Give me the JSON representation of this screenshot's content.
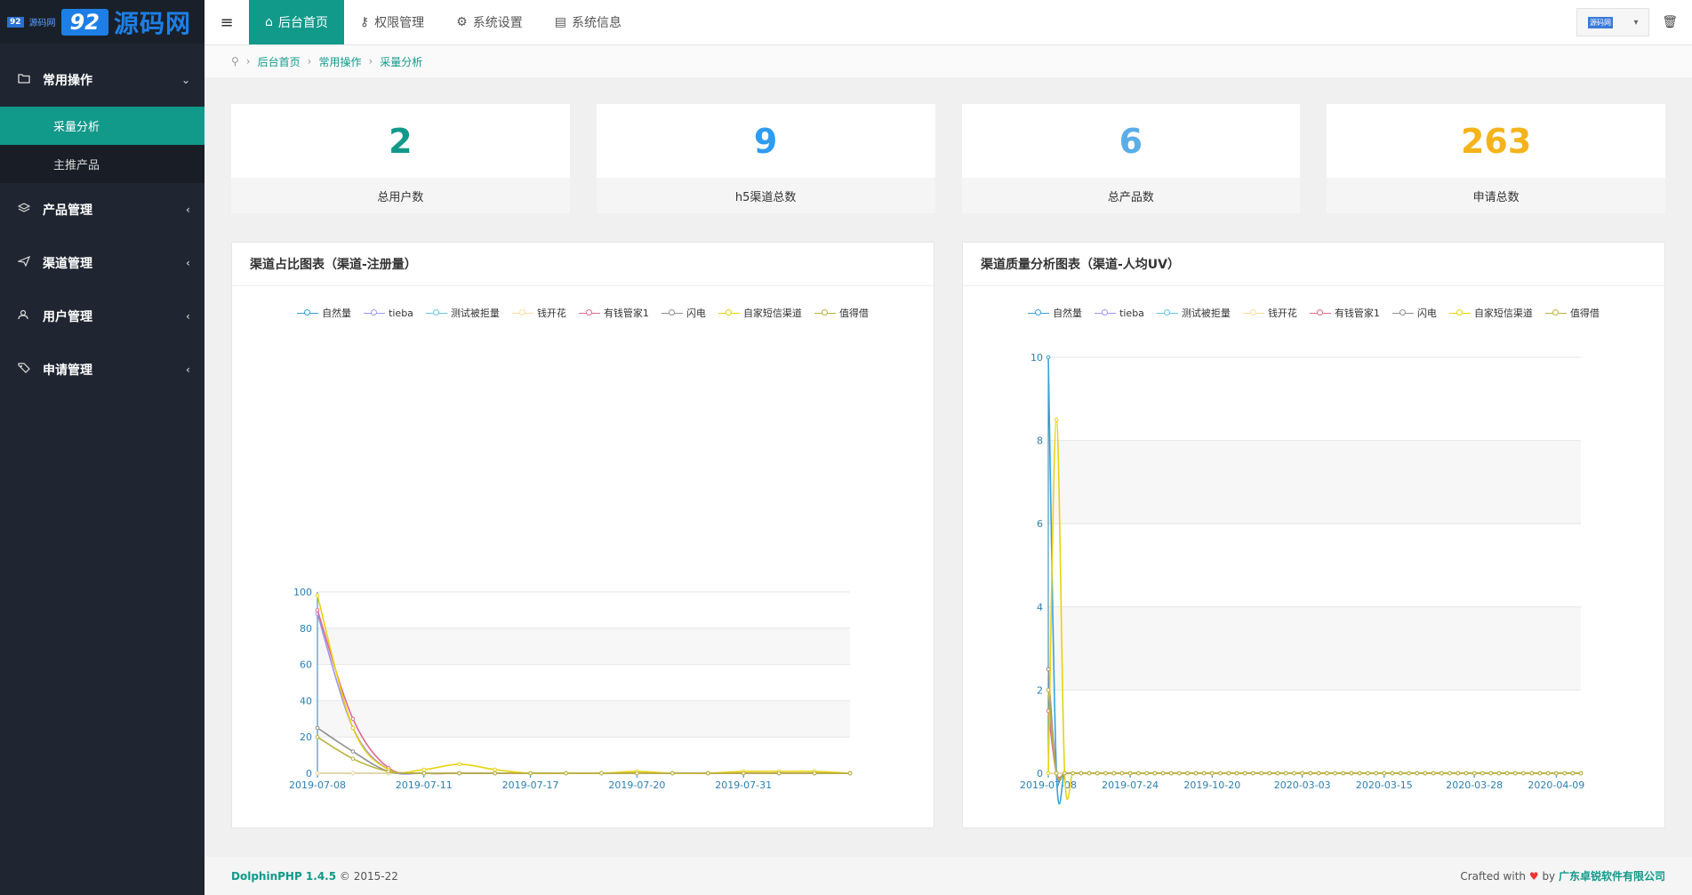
{
  "logo": {
    "badge": "92",
    "site_small": "源码网",
    "num": "92",
    "name": "源码网"
  },
  "sidebar": {
    "groups": [
      {
        "label": "常用操作",
        "icon": "folder-icon",
        "expanded": true,
        "items": [
          {
            "label": "采量分析",
            "active": true
          },
          {
            "label": "主推产品",
            "active": false
          }
        ]
      },
      {
        "label": "产品管理",
        "icon": "layers-icon"
      },
      {
        "label": "渠道管理",
        "icon": "send-icon"
      },
      {
        "label": "用户管理",
        "icon": "users-icon"
      },
      {
        "label": "申请管理",
        "icon": "tag-icon"
      }
    ]
  },
  "topbar": {
    "nav": [
      {
        "label": "后台首页",
        "icon": "home-icon",
        "active": true
      },
      {
        "label": "权限管理",
        "icon": "key-icon"
      },
      {
        "label": "系统设置",
        "icon": "gear-icon"
      },
      {
        "label": "系统信息",
        "icon": "file-icon"
      }
    ],
    "avatar_text": "源码网"
  },
  "breadcrumb": [
    "后台首页",
    "常用操作",
    "采量分析"
  ],
  "stats": [
    {
      "value": "2",
      "label": "总用户数",
      "color": "#11998a"
    },
    {
      "value": "9",
      "label": "h5渠道总数",
      "color": "#2e9cf0"
    },
    {
      "value": "6",
      "label": "总产品数",
      "color": "#5aaee8"
    },
    {
      "value": "263",
      "label": "申请总数",
      "color": "#f5b31b"
    }
  ],
  "panels": {
    "left_title": "渠道占比图表（渠道-注册量）",
    "right_title": "渠道质量分析图表（渠道-人均UV）"
  },
  "legend": [
    {
      "name": "自然量",
      "color": "#37a2da"
    },
    {
      "name": "tieba",
      "color": "#9d96f5"
    },
    {
      "name": "测试被拒量",
      "color": "#67c5e0"
    },
    {
      "name": "钱开花",
      "color": "#ffdb9c"
    },
    {
      "name": "有钱管家1",
      "color": "#e06a8c"
    },
    {
      "name": "闪电",
      "color": "#8f8f8f"
    },
    {
      "name": "自家短信渠道",
      "color": "#e8d20f"
    },
    {
      "name": "值得借",
      "color": "#b9b240"
    }
  ],
  "chart_data": [
    {
      "type": "line",
      "title": "渠道占比图表（渠道-注册量）",
      "x_tick_labels": [
        "2019-07-08",
        "2019-07-11",
        "2019-07-17",
        "2019-07-20",
        "2019-07-31"
      ],
      "ylim": [
        0,
        100
      ],
      "yticks": [
        0,
        20,
        40,
        60,
        80,
        100
      ],
      "point_count": 16,
      "series": [
        {
          "name": "自然量",
          "values": [
            0,
            0,
            0,
            0,
            0,
            0,
            0,
            0,
            0,
            0,
            0,
            0,
            0,
            0,
            0,
            0
          ]
        },
        {
          "name": "tieba",
          "values": [
            88,
            25,
            2,
            0,
            0,
            0,
            0,
            0,
            0,
            0,
            0,
            0,
            0,
            0,
            0,
            0
          ]
        },
        {
          "name": "测试被拒量",
          "values": [
            0,
            0,
            0,
            0,
            0,
            0,
            0,
            0,
            0,
            0,
            0,
            0,
            0,
            0,
            0,
            0
          ]
        },
        {
          "name": "钱开花",
          "values": [
            0,
            0,
            0,
            0,
            0,
            0,
            0,
            0,
            0,
            0,
            0,
            0,
            0,
            0,
            0,
            0
          ]
        },
        {
          "name": "有钱管家1",
          "values": [
            90,
            30,
            3,
            0,
            0,
            0,
            0,
            0,
            0,
            0,
            0,
            0,
            0,
            0,
            0,
            0
          ]
        },
        {
          "name": "闪电",
          "values": [
            25,
            12,
            1,
            0,
            0,
            0,
            0,
            0,
            0,
            0,
            0,
            0,
            0,
            0,
            0,
            0
          ]
        },
        {
          "name": "自家短信渠道",
          "values": [
            98,
            25,
            2,
            2,
            5,
            2,
            0,
            0,
            0,
            1,
            0,
            0,
            1,
            1,
            1,
            0
          ]
        },
        {
          "name": "值得借",
          "values": [
            20,
            8,
            1,
            0,
            0,
            0,
            0,
            0,
            0,
            0,
            0,
            0,
            0,
            0,
            0,
            0
          ]
        }
      ]
    },
    {
      "type": "line",
      "title": "渠道质量分析图表（渠道-人均UV）",
      "x_tick_labels": [
        "2019-07-08",
        "2019-07-24",
        "2019-10-20",
        "2020-03-03",
        "2020-03-15",
        "2020-03-28",
        "2020-04-09"
      ],
      "ylim": [
        0,
        10
      ],
      "yticks": [
        0,
        2,
        4,
        6,
        8,
        10
      ],
      "point_count": 66,
      "series": [
        {
          "name": "自然量",
          "values_head": [
            10,
            0
          ]
        },
        {
          "name": "tieba",
          "values_head": [
            2,
            0
          ]
        },
        {
          "name": "测试被拒量",
          "values_head": [
            0,
            0
          ]
        },
        {
          "name": "钱开花",
          "values_head": [
            0,
            0
          ]
        },
        {
          "name": "有钱管家1",
          "values_head": [
            1.5,
            0
          ]
        },
        {
          "name": "闪电",
          "values_head": [
            2.5,
            0
          ]
        },
        {
          "name": "自家短信渠道",
          "values_head": [
            0,
            8.5,
            0
          ]
        },
        {
          "name": "值得借",
          "values_head": [
            2,
            0
          ]
        }
      ]
    }
  ],
  "footer": {
    "brand": "DolphinPHP 1.4.5",
    "copyright": "© 2015-22",
    "crafted": "Crafted with",
    "by": "by",
    "company": "广东卓锐软件有限公司"
  }
}
